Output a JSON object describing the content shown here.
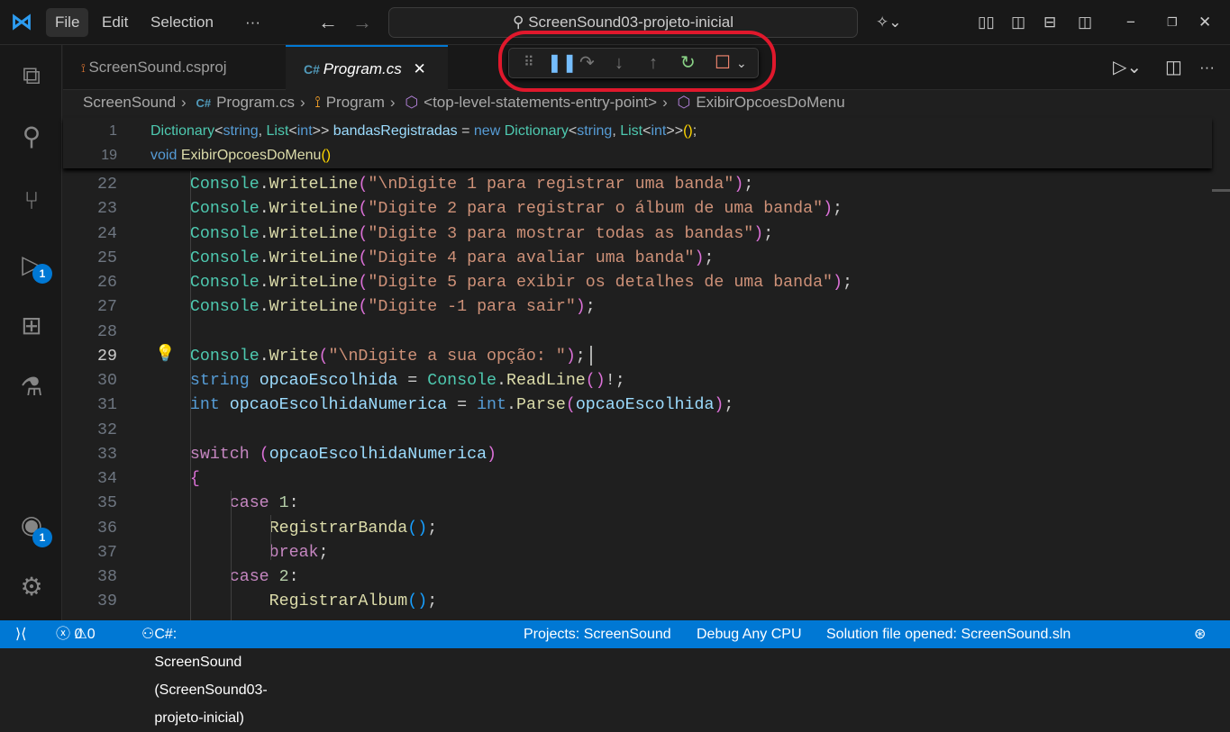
{
  "titlebar": {
    "menu": [
      "File",
      "Edit",
      "Selection",
      "···"
    ],
    "search": "ScreenSound03-projeto-inicial"
  },
  "activity": {
    "debug_badge": "1",
    "account_badge": "1"
  },
  "tabs": [
    {
      "label": "ScreenSound.csproj"
    },
    {
      "label": "Program.cs",
      "close": "✕"
    }
  ],
  "breadcrumb": [
    "ScreenSound",
    "Program.cs",
    "Program",
    "<top-level-statements-entry-point>",
    "ExibirOpcoesDoMenu"
  ],
  "sticky": [
    {
      "n": "1",
      "t": [
        [
          "ty",
          "Dictionary"
        ],
        [
          "pl",
          "<"
        ],
        [
          "kw",
          "string"
        ],
        [
          "pl",
          ", "
        ],
        [
          "ty",
          "List"
        ],
        [
          "pl",
          "<"
        ],
        [
          "kw",
          "int"
        ],
        [
          "pl",
          ">> "
        ],
        [
          "va",
          "bandasRegistradas"
        ],
        [
          "pl",
          " = "
        ],
        [
          "kw",
          "new"
        ],
        [
          "pl",
          " "
        ],
        [
          "ty",
          "Dictionary"
        ],
        [
          "pl",
          "<"
        ],
        [
          "kw",
          "string"
        ],
        [
          "pl",
          ", "
        ],
        [
          "ty",
          "List"
        ],
        [
          "pl",
          "<"
        ],
        [
          "kw",
          "int"
        ],
        [
          "pl",
          ">>"
        ],
        [
          "b1",
          "()"
        ],
        [
          "pl",
          ";"
        ]
      ]
    },
    {
      "n": "19",
      "t": [
        [
          "kw",
          "void"
        ],
        [
          "pl",
          " "
        ],
        [
          "fn",
          "ExibirOpcoesDoMenu"
        ],
        [
          "b1",
          "()"
        ]
      ]
    }
  ],
  "code": [
    {
      "n": "22",
      "t": [
        [
          "pl",
          "    "
        ],
        [
          "ty",
          "Console"
        ],
        [
          "pl",
          "."
        ],
        [
          "fn",
          "WriteLine"
        ],
        [
          "b2",
          "("
        ],
        [
          "st",
          "\"\\nDigite 1 para registrar uma banda\""
        ],
        [
          "b2",
          ")"
        ],
        [
          "pl",
          ";"
        ]
      ]
    },
    {
      "n": "23",
      "t": [
        [
          "pl",
          "    "
        ],
        [
          "ty",
          "Console"
        ],
        [
          "pl",
          "."
        ],
        [
          "fn",
          "WriteLine"
        ],
        [
          "b2",
          "("
        ],
        [
          "st",
          "\"Digite 2 para registrar o álbum de uma banda\""
        ],
        [
          "b2",
          ")"
        ],
        [
          "pl",
          ";"
        ]
      ]
    },
    {
      "n": "24",
      "t": [
        [
          "pl",
          "    "
        ],
        [
          "ty",
          "Console"
        ],
        [
          "pl",
          "."
        ],
        [
          "fn",
          "WriteLine"
        ],
        [
          "b2",
          "("
        ],
        [
          "st",
          "\"Digite 3 para mostrar todas as bandas\""
        ],
        [
          "b2",
          ")"
        ],
        [
          "pl",
          ";"
        ]
      ]
    },
    {
      "n": "25",
      "t": [
        [
          "pl",
          "    "
        ],
        [
          "ty",
          "Console"
        ],
        [
          "pl",
          "."
        ],
        [
          "fn",
          "WriteLine"
        ],
        [
          "b2",
          "("
        ],
        [
          "st",
          "\"Digite 4 para avaliar uma banda\""
        ],
        [
          "b2",
          ")"
        ],
        [
          "pl",
          ";"
        ]
      ]
    },
    {
      "n": "26",
      "t": [
        [
          "pl",
          "    "
        ],
        [
          "ty",
          "Console"
        ],
        [
          "pl",
          "."
        ],
        [
          "fn",
          "WriteLine"
        ],
        [
          "b2",
          "("
        ],
        [
          "st",
          "\"Digite 5 para exibir os detalhes de uma banda\""
        ],
        [
          "b2",
          ")"
        ],
        [
          "pl",
          ";"
        ]
      ]
    },
    {
      "n": "27",
      "t": [
        [
          "pl",
          "    "
        ],
        [
          "ty",
          "Console"
        ],
        [
          "pl",
          "."
        ],
        [
          "fn",
          "WriteLine"
        ],
        [
          "b2",
          "("
        ],
        [
          "st",
          "\"Digite -1 para sair\""
        ],
        [
          "b2",
          ")"
        ],
        [
          "pl",
          ";"
        ]
      ]
    },
    {
      "n": "28",
      "t": []
    },
    {
      "n": "29",
      "t": [
        [
          "pl",
          "    "
        ],
        [
          "ty",
          "Console"
        ],
        [
          "pl",
          "."
        ],
        [
          "fn",
          "Write"
        ],
        [
          "b2",
          "("
        ],
        [
          "st",
          "\"\\nDigite a sua opção: \""
        ],
        [
          "b2",
          ")"
        ],
        [
          "pl",
          ";"
        ]
      ]
    },
    {
      "n": "30",
      "t": [
        [
          "pl",
          "    "
        ],
        [
          "kw",
          "string"
        ],
        [
          "pl",
          " "
        ],
        [
          "va",
          "opcaoEscolhida"
        ],
        [
          "pl",
          " = "
        ],
        [
          "ty",
          "Console"
        ],
        [
          "pl",
          "."
        ],
        [
          "fn",
          "ReadLine"
        ],
        [
          "b2",
          "()"
        ],
        [
          "pl",
          "!;"
        ]
      ]
    },
    {
      "n": "31",
      "t": [
        [
          "pl",
          "    "
        ],
        [
          "kw",
          "int"
        ],
        [
          "pl",
          " "
        ],
        [
          "va",
          "opcaoEscolhidaNumerica"
        ],
        [
          "pl",
          " = "
        ],
        [
          "kw",
          "int"
        ],
        [
          "pl",
          "."
        ],
        [
          "fn",
          "Parse"
        ],
        [
          "b2",
          "("
        ],
        [
          "va",
          "opcaoEscolhida"
        ],
        [
          "b2",
          ")"
        ],
        [
          "pl",
          ";"
        ]
      ]
    },
    {
      "n": "32",
      "t": []
    },
    {
      "n": "33",
      "t": [
        [
          "pl",
          "    "
        ],
        [
          "ct",
          "switch"
        ],
        [
          "pl",
          " "
        ],
        [
          "b2",
          "("
        ],
        [
          "va",
          "opcaoEscolhidaNumerica"
        ],
        [
          "b2",
          ")"
        ]
      ]
    },
    {
      "n": "34",
      "t": [
        [
          "pl",
          "    "
        ],
        [
          "b2",
          "{"
        ]
      ]
    },
    {
      "n": "35",
      "t": [
        [
          "pl",
          "        "
        ],
        [
          "ct",
          "case"
        ],
        [
          "pl",
          " "
        ],
        [
          "nu",
          "1"
        ],
        [
          "pl",
          ":"
        ]
      ]
    },
    {
      "n": "36",
      "t": [
        [
          "pl",
          "            "
        ],
        [
          "fn",
          "RegistrarBanda"
        ],
        [
          "b3",
          "()"
        ],
        [
          "pl",
          ";"
        ]
      ]
    },
    {
      "n": "37",
      "t": [
        [
          "pl",
          "            "
        ],
        [
          "ct",
          "break"
        ],
        [
          "pl",
          ";"
        ]
      ]
    },
    {
      "n": "38",
      "t": [
        [
          "pl",
          "        "
        ],
        [
          "ct",
          "case"
        ],
        [
          "pl",
          " "
        ],
        [
          "nu",
          "2"
        ],
        [
          "pl",
          ":"
        ]
      ]
    },
    {
      "n": "39",
      "t": [
        [
          "pl",
          "            "
        ],
        [
          "fn",
          "RegistrarAlbum"
        ],
        [
          "b3",
          "()"
        ],
        [
          "pl",
          ";"
        ]
      ]
    }
  ],
  "current_line": "29",
  "status": {
    "errors": "0",
    "warnings": "0",
    "project": "C#: ScreenSound (ScreenSound03-projeto-inicial)",
    "projects": "Projects: ScreenSound",
    "config": "Debug Any CPU",
    "solution": "Solution file opened: ScreenSound.sln"
  },
  "colors": {
    "accent": "#0078d4",
    "annotation": "#e0182c"
  }
}
